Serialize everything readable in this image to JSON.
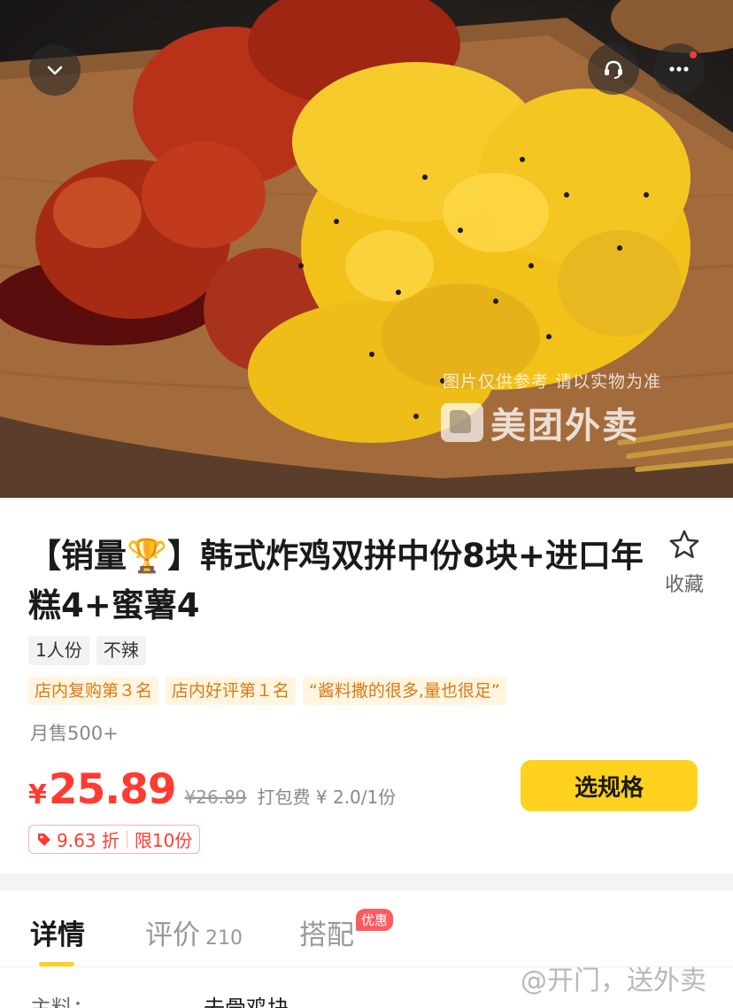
{
  "hero": {
    "watermark_note": "图片仅供参考 请以实物为准",
    "watermark_brand": "美团外卖",
    "icons": {
      "collapse": "chevron-down-icon",
      "service": "customer-service-icon",
      "more": "more-dots-icon"
    }
  },
  "product": {
    "title": "【销量🏆】韩式炸鸡双拼中份8块+进口年糕4+蜜薯4",
    "favorite_label": "收藏",
    "tags": [
      "1人份",
      "不辣"
    ],
    "ranks": [
      "店内复购第３名",
      "店内好评第１名",
      "“酱料撒的很多,量也很足”"
    ],
    "monthly_sales": "月售500+",
    "currency": "¥",
    "price": "25.89",
    "original_price": "¥26.89",
    "packing_fee": "打包费 ¥ 2.0/1份",
    "choose_button": "选规格",
    "discount": "9.63 折",
    "limit": "限10份"
  },
  "tabs": [
    {
      "label": "详情",
      "count": "",
      "badge": ""
    },
    {
      "label": "评价",
      "count": "210",
      "badge": ""
    },
    {
      "label": "搭配",
      "count": "",
      "badge": "优惠"
    }
  ],
  "details": {
    "label": "主料：",
    "value": "去骨鸡块"
  },
  "corner_watermark": "@开门，送外卖",
  "colors": {
    "accent_yellow": "#ffd21f",
    "price_red": "#ff3b30",
    "rank_orange": "#d97a14"
  }
}
